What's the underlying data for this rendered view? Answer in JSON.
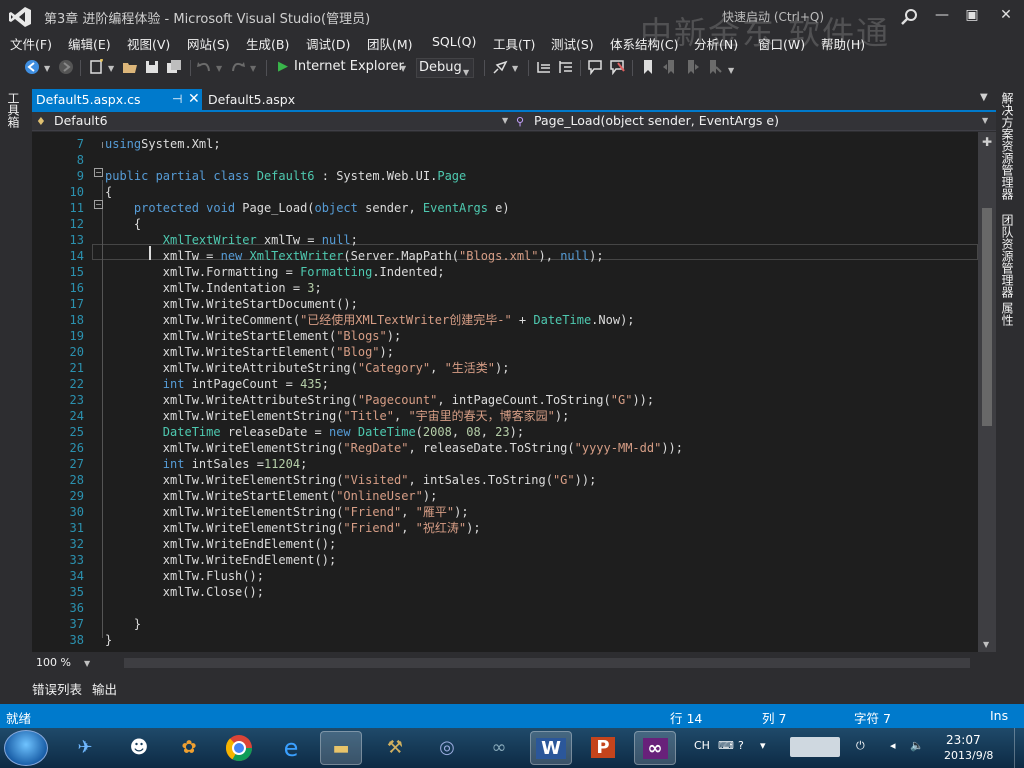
{
  "window": {
    "title": "第3章  进阶编程体验 - Microsoft Visual Studio(管理员)",
    "quick_launch": "快速启动 (Ctrl+Q)",
    "watermark": "中新金东  软件通",
    "minimize": "—",
    "restore": "▣",
    "close": "✕"
  },
  "menu": [
    "文件(F)",
    "编辑(E)",
    "视图(V)",
    "网站(S)",
    "生成(B)",
    "调试(D)",
    "团队(M)",
    "SQL(Q)",
    "工具(T)",
    "测试(S)",
    "体系结构(C)",
    "分析(N)",
    "窗口(W)",
    "帮助(H)"
  ],
  "toolbar": {
    "run_target": "Internet Explorer",
    "configuration": "Debug"
  },
  "left_tabs": {
    "toolbox": "工具箱"
  },
  "right_tabs": [
    "解决方案资源管理器",
    "团队资源管理器",
    "属性"
  ],
  "tabs": {
    "active": "Default5.aspx.cs",
    "pin": "⊣",
    "close": "✕",
    "second": "Default5.aspx"
  },
  "navbar": {
    "class_name": "Default6",
    "member": "Page_Load(object sender, EventArgs e)"
  },
  "editor": {
    "lines": [
      {
        "n": "7",
        "tokens": [
          [
            "kw",
            "using"
          ],
          [
            "",
            "System.Xml;"
          ]
        ]
      },
      {
        "n": "8",
        "tokens": []
      },
      {
        "n": "9",
        "tokens": [
          [
            "kw",
            "public partial class "
          ],
          [
            "ty",
            "Default6"
          ],
          [
            "",
            " : System.Web.UI."
          ],
          [
            "ty",
            "Page"
          ]
        ]
      },
      {
        "n": "10",
        "tokens": [
          [
            "",
            "{"
          ]
        ]
      },
      {
        "n": "11",
        "tokens": [
          [
            "",
            "    "
          ],
          [
            "kw",
            "protected void "
          ],
          [
            "",
            "Page_Load("
          ],
          [
            "kw",
            "object"
          ],
          [
            "",
            " sender, "
          ],
          [
            "ty",
            "EventArgs"
          ],
          [
            "",
            " e)"
          ]
        ]
      },
      {
        "n": "12",
        "tokens": [
          [
            "",
            "    {"
          ]
        ]
      },
      {
        "n": "13",
        "tokens": [
          [
            "",
            "        "
          ],
          [
            "ty",
            "XmlTextWriter"
          ],
          [
            "",
            " xmlTw = "
          ],
          [
            "kw",
            "null"
          ],
          [
            "",
            ";"
          ]
        ]
      },
      {
        "n": "14",
        "tokens": [
          [
            "",
            "        xmlTw = "
          ],
          [
            "kw",
            "new "
          ],
          [
            "ty",
            "XmlTextWriter"
          ],
          [
            "",
            "(Server.MapPath("
          ],
          [
            "st",
            "\"Blogs.xml\""
          ],
          [
            "",
            "), "
          ],
          [
            "kw",
            "null"
          ],
          [
            "",
            ");"
          ]
        ]
      },
      {
        "n": "15",
        "tokens": [
          [
            "",
            "        xmlTw.Formatting = "
          ],
          [
            "ty",
            "Formatting"
          ],
          [
            "",
            ".Indented;"
          ]
        ]
      },
      {
        "n": "16",
        "tokens": [
          [
            "",
            "        xmlTw.Indentation = "
          ],
          [
            "nu",
            "3"
          ],
          [
            "",
            ";"
          ]
        ]
      },
      {
        "n": "17",
        "tokens": [
          [
            "",
            "        xmlTw.WriteStartDocument();"
          ]
        ]
      },
      {
        "n": "18",
        "tokens": [
          [
            "",
            "        xmlTw.WriteComment("
          ],
          [
            "st",
            "\"已经使用XMLTextWriter创建完毕-\""
          ],
          [
            "",
            " + "
          ],
          [
            "ty",
            "DateTime"
          ],
          [
            "",
            ".Now);"
          ]
        ]
      },
      {
        "n": "19",
        "tokens": [
          [
            "",
            "        xmlTw.WriteStartElement("
          ],
          [
            "st",
            "\"Blogs\""
          ],
          [
            "",
            ");"
          ]
        ]
      },
      {
        "n": "20",
        "tokens": [
          [
            "",
            "        xmlTw.WriteStartElement("
          ],
          [
            "st",
            "\"Blog\""
          ],
          [
            "",
            ");"
          ]
        ]
      },
      {
        "n": "21",
        "tokens": [
          [
            "",
            "        xmlTw.WriteAttributeString("
          ],
          [
            "st",
            "\"Category\""
          ],
          [
            "",
            ", "
          ],
          [
            "st",
            "\"生活类\""
          ],
          [
            "",
            ");"
          ]
        ]
      },
      {
        "n": "22",
        "tokens": [
          [
            "",
            "        "
          ],
          [
            "kw",
            "int"
          ],
          [
            "",
            " intPageCount = "
          ],
          [
            "nu",
            "435"
          ],
          [
            "",
            ";"
          ]
        ]
      },
      {
        "n": "23",
        "tokens": [
          [
            "",
            "        xmlTw.WriteAttributeString("
          ],
          [
            "st",
            "\"Pagecount\""
          ],
          [
            "",
            ", intPageCount.ToString("
          ],
          [
            "st",
            "\"G\""
          ],
          [
            "",
            "));"
          ]
        ]
      },
      {
        "n": "24",
        "tokens": [
          [
            "",
            "        xmlTw.WriteElementString("
          ],
          [
            "st",
            "\"Title\""
          ],
          [
            "",
            ", "
          ],
          [
            "st",
            "\"宇宙里的春天，博客家园\""
          ],
          [
            "",
            ");"
          ]
        ]
      },
      {
        "n": "25",
        "tokens": [
          [
            "",
            "        "
          ],
          [
            "ty",
            "DateTime"
          ],
          [
            "",
            " releaseDate = "
          ],
          [
            "kw",
            "new "
          ],
          [
            "ty",
            "DateTime"
          ],
          [
            "",
            "("
          ],
          [
            "nu",
            "2008"
          ],
          [
            "",
            ", "
          ],
          [
            "nu",
            "08"
          ],
          [
            "",
            ", "
          ],
          [
            "nu",
            "23"
          ],
          [
            "",
            ");"
          ]
        ]
      },
      {
        "n": "26",
        "tokens": [
          [
            "",
            "        xmlTw.WriteElementString("
          ],
          [
            "st",
            "\"RegDate\""
          ],
          [
            "",
            ", releaseDate.ToString("
          ],
          [
            "st",
            "\"yyyy-MM-dd\""
          ],
          [
            "",
            "));"
          ]
        ]
      },
      {
        "n": "27",
        "tokens": [
          [
            "",
            "        "
          ],
          [
            "kw",
            "int"
          ],
          [
            "",
            " intSales ="
          ],
          [
            "nu",
            "11204"
          ],
          [
            "",
            ";"
          ]
        ]
      },
      {
        "n": "28",
        "tokens": [
          [
            "",
            "        xmlTw.WriteElementString("
          ],
          [
            "st",
            "\"Visited\""
          ],
          [
            "",
            ", intSales.ToString("
          ],
          [
            "st",
            "\"G\""
          ],
          [
            "",
            "));"
          ]
        ]
      },
      {
        "n": "29",
        "tokens": [
          [
            "",
            "        xmlTw.WriteStartElement("
          ],
          [
            "st",
            "\"OnlineUser\""
          ],
          [
            "",
            ");"
          ]
        ]
      },
      {
        "n": "30",
        "tokens": [
          [
            "",
            "        xmlTw.WriteElementString("
          ],
          [
            "st",
            "\"Friend\""
          ],
          [
            "",
            ", "
          ],
          [
            "st",
            "\"雁平\""
          ],
          [
            "",
            ");"
          ]
        ]
      },
      {
        "n": "31",
        "tokens": [
          [
            "",
            "        xmlTw.WriteElementString("
          ],
          [
            "st",
            "\"Friend\""
          ],
          [
            "",
            ", "
          ],
          [
            "st",
            "\"祝红涛\""
          ],
          [
            "",
            ");"
          ]
        ]
      },
      {
        "n": "32",
        "tokens": [
          [
            "",
            "        xmlTw.WriteEndElement();"
          ]
        ]
      },
      {
        "n": "33",
        "tokens": [
          [
            "",
            "        xmlTw.WriteEndElement();"
          ]
        ]
      },
      {
        "n": "34",
        "tokens": [
          [
            "",
            "        xmlTw.Flush();"
          ]
        ]
      },
      {
        "n": "35",
        "tokens": [
          [
            "",
            "        xmlTw.Close();"
          ]
        ]
      },
      {
        "n": "36",
        "tokens": []
      },
      {
        "n": "37",
        "tokens": [
          [
            "",
            "    }"
          ]
        ]
      },
      {
        "n": "38",
        "tokens": [
          [
            "",
            "}"
          ]
        ]
      }
    ]
  },
  "zoom": "100 %",
  "output_tabs": [
    "错误列表",
    "输出"
  ],
  "status": {
    "state": "就绪",
    "row": "行 14",
    "col": "列 7",
    "char": "字符 7",
    "mode": "Ins"
  },
  "taskbar": {
    "lang": "CH",
    "time": "23:07",
    "date": "2013/9/8"
  },
  "colors": {
    "accent": "#007acc",
    "keyword": "#569cd6",
    "type": "#4ec9b0",
    "string": "#d69d85",
    "line_number": "#2b91af"
  }
}
